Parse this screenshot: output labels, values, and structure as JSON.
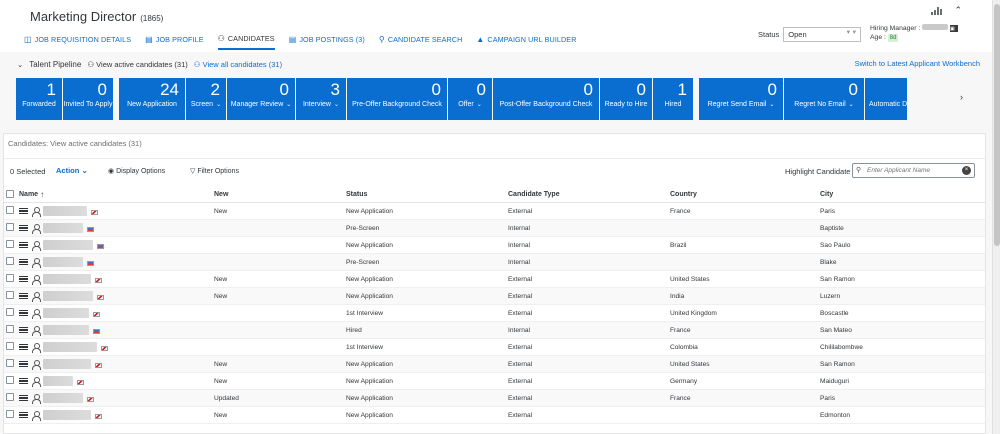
{
  "header": {
    "title": "Marketing Director",
    "req_id": "(1865)",
    "status_label": "Status",
    "status_value": "Open",
    "hiring_manager_label": "Hiring Manager :",
    "age_label": "Age :",
    "age_value": "8d"
  },
  "tabs": [
    {
      "label": "JOB REQUISITION DETAILS",
      "icon": "document-icon"
    },
    {
      "label": "JOB PROFILE",
      "icon": "profile-icon"
    },
    {
      "label": "CANDIDATES",
      "icon": "people-icon",
      "active": true
    },
    {
      "label": "JOB POSTINGS (3)",
      "icon": "postings-icon"
    },
    {
      "label": "CANDIDATE SEARCH",
      "icon": "search-icon"
    },
    {
      "label": "CAMPAIGN URL BUILDER",
      "icon": "megaphone-icon"
    }
  ],
  "pipeline": {
    "title": "Talent Pipeline",
    "active_link": "View active candidates (31)",
    "all_link": "View all candidates (31)",
    "switch_link": "Switch to Latest Applicant Workbench",
    "stages": [
      {
        "label": "Forwarded",
        "count": "1",
        "dropdown": false
      },
      {
        "label": "Invited To Apply",
        "count": "0",
        "dropdown": false
      },
      {
        "label": "New Application",
        "count": "24",
        "dropdown": false
      },
      {
        "label": "Screen",
        "count": "2",
        "dropdown": true
      },
      {
        "label": "Manager Review",
        "count": "0",
        "dropdown": true
      },
      {
        "label": "Interview",
        "count": "3",
        "dropdown": true
      },
      {
        "label": "Pre-Offer Background Check",
        "count": "0",
        "dropdown": false
      },
      {
        "label": "Offer",
        "count": "0",
        "dropdown": true
      },
      {
        "label": "Post-Offer Background Check",
        "count": "0",
        "dropdown": false
      },
      {
        "label": "Ready to Hire",
        "count": "0",
        "dropdown": false
      },
      {
        "label": "Hired",
        "count": "1",
        "dropdown": false
      },
      {
        "label": "Regret Send Email",
        "count": "0",
        "dropdown": true
      },
      {
        "label": "Regret No Email",
        "count": "0",
        "dropdown": true
      },
      {
        "label": "Automatic D",
        "count": "",
        "dropdown": false
      }
    ]
  },
  "candidates": {
    "panel_title": "Candidates: View active candidates (31)",
    "selected": "0 Selected",
    "action": "Action",
    "display_options": "Display Options",
    "filter_options": "Filter Options",
    "highlight_label": "Highlight Candidate",
    "search_placeholder": "Enter Applicant Name",
    "columns": [
      "Name",
      "New",
      "Status",
      "Candidate Type",
      "Country",
      "City"
    ],
    "rows": [
      {
        "new": "New",
        "status": "New Application",
        "type": "External",
        "country": "France",
        "city": "Paris",
        "flag": "red"
      },
      {
        "new": "",
        "status": "Pre-Screen",
        "type": "Internal",
        "country": "",
        "city": "Baptiste",
        "flag": "blue"
      },
      {
        "new": "",
        "status": "New Application",
        "type": "Internal",
        "country": "Brazil",
        "city": "Sao Paulo",
        "flag": "blue"
      },
      {
        "new": "",
        "status": "Pre-Screen",
        "type": "Internal",
        "country": "",
        "city": "Blake",
        "flag": "blue"
      },
      {
        "new": "New",
        "status": "New Application",
        "type": "External",
        "country": "United States",
        "city": "San Ramon",
        "flag": "red"
      },
      {
        "new": "New",
        "status": "New Application",
        "type": "External",
        "country": "India",
        "city": "Luzern",
        "flag": "red"
      },
      {
        "new": "",
        "status": "1st Interview",
        "type": "External",
        "country": "United Kingdom",
        "city": "Boscastle",
        "flag": "red"
      },
      {
        "new": "",
        "status": "Hired",
        "type": "Internal",
        "country": "France",
        "city": "San Mateo",
        "flag": "blue"
      },
      {
        "new": "",
        "status": "1st Interview",
        "type": "External",
        "country": "Colombia",
        "city": "Chililabombwe",
        "flag": "red"
      },
      {
        "new": "New",
        "status": "New Application",
        "type": "External",
        "country": "United States",
        "city": "San Ramon",
        "flag": "red"
      },
      {
        "new": "New",
        "status": "New Application",
        "type": "External",
        "country": "Germany",
        "city": "Maiduguri",
        "flag": "red"
      },
      {
        "new": "Updated",
        "status": "New Application",
        "type": "External",
        "country": "France",
        "city": "Paris",
        "flag": "red"
      },
      {
        "new": "New",
        "status": "New Application",
        "type": "External",
        "country": "",
        "city": "Edmonton",
        "flag": "red"
      }
    ]
  }
}
